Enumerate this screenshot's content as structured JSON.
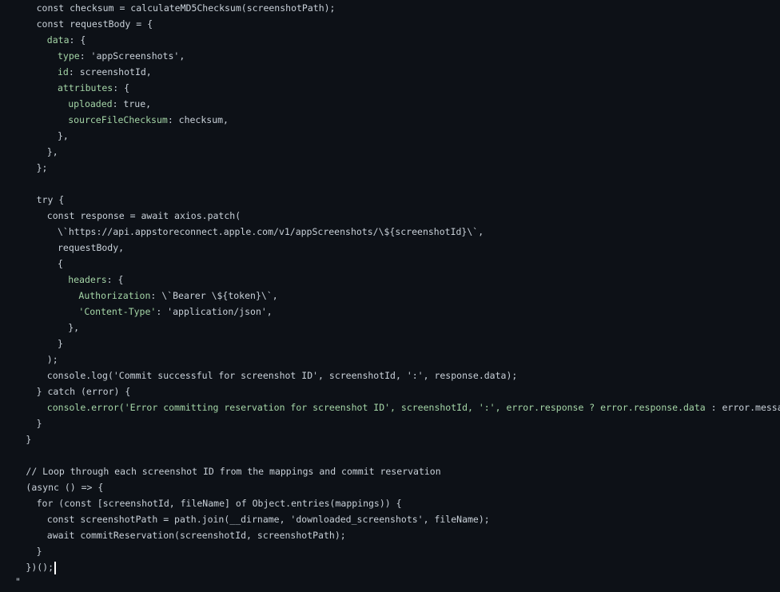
{
  "code_lines": [
    {
      "indent": 3,
      "tokens": [
        [
          "w",
          "const checksum = calculateMD5Checksum(screenshotPath);"
        ]
      ]
    },
    {
      "indent": 3,
      "tokens": [
        [
          "w",
          "const requestBody = {"
        ]
      ]
    },
    {
      "indent": 4,
      "tokens": [
        [
          "p",
          "data"
        ],
        [
          "w",
          ": {"
        ]
      ]
    },
    {
      "indent": 5,
      "tokens": [
        [
          "p",
          "type"
        ],
        [
          "w",
          ": 'appScreenshots',"
        ]
      ]
    },
    {
      "indent": 5,
      "tokens": [
        [
          "p",
          "id"
        ],
        [
          "w",
          ": screenshotId,"
        ]
      ]
    },
    {
      "indent": 5,
      "tokens": [
        [
          "p",
          "attributes"
        ],
        [
          "w",
          ": {"
        ]
      ]
    },
    {
      "indent": 6,
      "tokens": [
        [
          "p",
          "uploaded"
        ],
        [
          "w",
          ": true,"
        ]
      ]
    },
    {
      "indent": 6,
      "tokens": [
        [
          "p",
          "sourceFileChecksum"
        ],
        [
          "w",
          ": checksum,"
        ]
      ]
    },
    {
      "indent": 5,
      "tokens": [
        [
          "w",
          "},"
        ]
      ]
    },
    {
      "indent": 4,
      "tokens": [
        [
          "w",
          "},"
        ]
      ]
    },
    {
      "indent": 3,
      "tokens": [
        [
          "w",
          "};"
        ]
      ]
    },
    {
      "indent": 0,
      "tokens": []
    },
    {
      "indent": 3,
      "tokens": [
        [
          "w",
          "try {"
        ]
      ]
    },
    {
      "indent": 4,
      "tokens": [
        [
          "w",
          "const response = await axios.patch("
        ]
      ]
    },
    {
      "indent": 5,
      "tokens": [
        [
          "w",
          "\\`https://api.appstoreconnect.apple.com/v1/appScreenshots/\\${screenshotId}\\`,"
        ]
      ]
    },
    {
      "indent": 5,
      "tokens": [
        [
          "w",
          "requestBody,"
        ]
      ]
    },
    {
      "indent": 5,
      "tokens": [
        [
          "w",
          "{"
        ]
      ]
    },
    {
      "indent": 6,
      "tokens": [
        [
          "p",
          "headers"
        ],
        [
          "w",
          ": {"
        ]
      ]
    },
    {
      "indent": 7,
      "tokens": [
        [
          "p",
          "Authorization"
        ],
        [
          "w",
          ": \\`Bearer \\${token}\\`,"
        ]
      ]
    },
    {
      "indent": 7,
      "tokens": [
        [
          "p",
          "'Content-Type'"
        ],
        [
          "w",
          ": 'application/json',"
        ]
      ]
    },
    {
      "indent": 6,
      "tokens": [
        [
          "w",
          "},"
        ]
      ]
    },
    {
      "indent": 5,
      "tokens": [
        [
          "w",
          "}"
        ]
      ]
    },
    {
      "indent": 4,
      "tokens": [
        [
          "w",
          ");"
        ]
      ]
    },
    {
      "indent": 4,
      "tokens": [
        [
          "w",
          "console.log('Commit successful for screenshot ID', screenshotId, ':', response.data);"
        ]
      ]
    },
    {
      "indent": 3,
      "tokens": [
        [
          "w",
          "} catch (error) {"
        ]
      ]
    },
    {
      "indent": 4,
      "tokens": [
        [
          "p",
          "console.error('Error committing reservation for screenshot ID', screenshotId, ':', error.response ? error.response.data"
        ],
        [
          "w",
          " : error.message);"
        ]
      ]
    },
    {
      "indent": 3,
      "tokens": [
        [
          "w",
          "}"
        ]
      ]
    },
    {
      "indent": 2,
      "tokens": [
        [
          "w",
          "}"
        ]
      ]
    },
    {
      "indent": 0,
      "tokens": []
    },
    {
      "indent": 2,
      "tokens": [
        [
          "w",
          "// Loop through each screenshot ID from the mappings and commit reservation"
        ]
      ]
    },
    {
      "indent": 2,
      "tokens": [
        [
          "w",
          "(async () => {"
        ]
      ]
    },
    {
      "indent": 3,
      "tokens": [
        [
          "w",
          "for (const [screenshotId, fileName] of Object.entries(mappings)) {"
        ]
      ]
    },
    {
      "indent": 4,
      "tokens": [
        [
          "w",
          "const screenshotPath = path.join(__dirname, 'downloaded_screenshots', fileName);"
        ]
      ]
    },
    {
      "indent": 4,
      "tokens": [
        [
          "w",
          "await commitReservation(screenshotId, screenshotPath);"
        ]
      ]
    },
    {
      "indent": 3,
      "tokens": [
        [
          "w",
          "}"
        ]
      ]
    },
    {
      "indent": 2,
      "tokens": [
        [
          "w",
          "})();"
        ]
      ],
      "cursor": true
    }
  ],
  "trailing_mark": "\""
}
